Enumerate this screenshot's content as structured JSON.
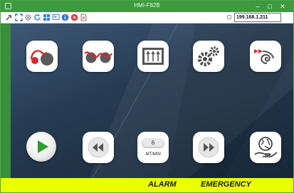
{
  "window": {
    "title": "HMI-F82B"
  },
  "titlebar": {
    "app_icon": "app-window-icon",
    "minimize_glyph": "–",
    "maximize_glyph": "□",
    "close_glyph": "✕"
  },
  "toolbar": {
    "ip_address": "199.168.1.211",
    "icons": [
      "tools-icon",
      "fullscreen-icon",
      "settings-icon",
      "refresh-icon",
      "windows-icon",
      "screen-icon",
      "info-icon",
      "record-icon",
      "document-icon"
    ]
  },
  "main": {
    "top_row": [
      {
        "name": "unwind-module-icon"
      },
      {
        "name": "rollers-module-icon"
      },
      {
        "name": "press-module-icon"
      },
      {
        "name": "gears-settings-icon"
      },
      {
        "name": "rewind-spiral-icon"
      }
    ],
    "bottom_row": {
      "play": "play-icon",
      "rewind": "fast-backward-icon",
      "speed": {
        "value": "6",
        "unit": "MT/MIN"
      },
      "forward": "fast-forward-icon",
      "globe": "globe-hand-icon"
    }
  },
  "status": {
    "alarm_label": "ALARM",
    "emergency_label": "EMERGENCY"
  },
  "colors": {
    "frame_green": "#3e9a3e",
    "alarm_yellow": "#eaff00",
    "accent_red": "#d42a2a",
    "play_green": "#2e9e2e",
    "dark_gray": "#555555",
    "panel_blue": "#263b52"
  }
}
